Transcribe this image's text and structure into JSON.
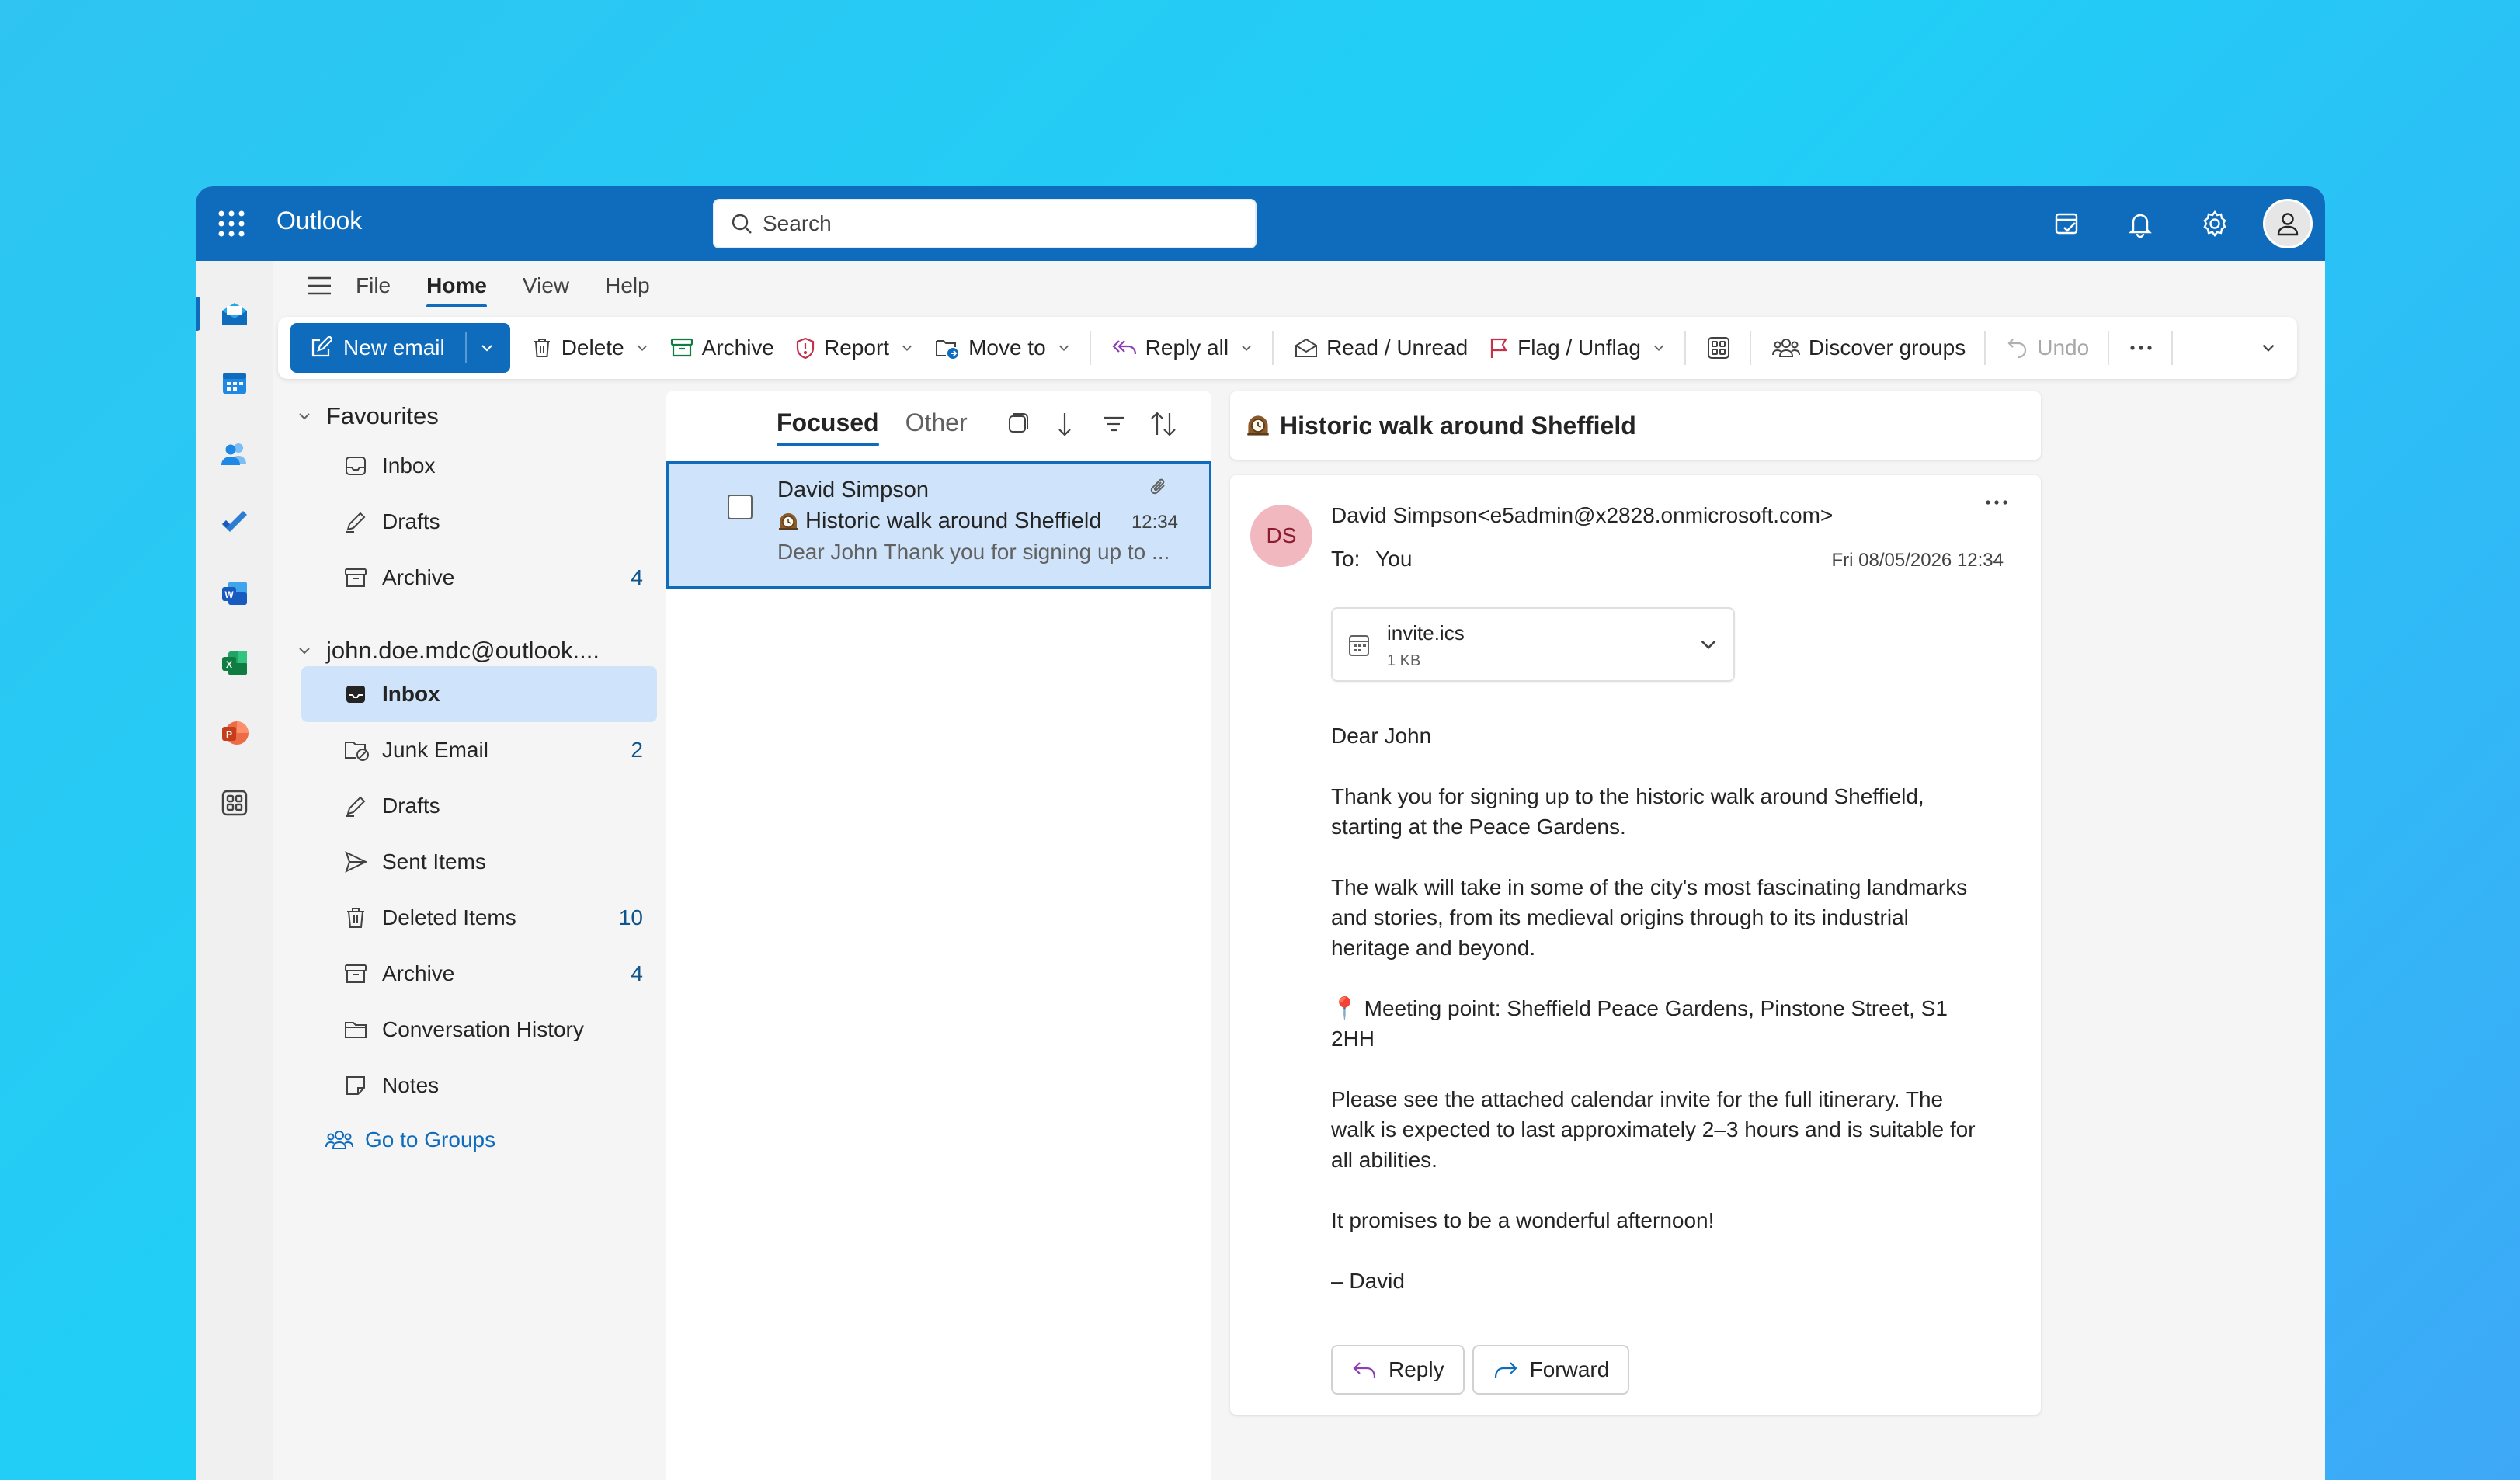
{
  "app": {
    "title": "Outlook"
  },
  "search": {
    "placeholder": "Search"
  },
  "menu": {
    "tabs": [
      "File",
      "Home",
      "View",
      "Help"
    ],
    "selected": "Home"
  },
  "ribbon": {
    "new_email": "New email",
    "delete": "Delete",
    "archive": "Archive",
    "report": "Report",
    "move_to": "Move to",
    "reply_all": "Reply all",
    "read_unread": "Read / Unread",
    "flag_unflag": "Flag / Unflag",
    "discover_groups": "Discover groups",
    "undo": "Undo"
  },
  "favourites": {
    "header": "Favourites",
    "items": [
      {
        "label": "Inbox",
        "count": ""
      },
      {
        "label": "Drafts",
        "count": ""
      },
      {
        "label": "Archive",
        "count": "4"
      }
    ]
  },
  "account": {
    "header": "john.doe.mdc@outlook....",
    "items": [
      {
        "label": "Inbox",
        "count": "",
        "selected": true
      },
      {
        "label": "Junk Email",
        "count": "2"
      },
      {
        "label": "Drafts",
        "count": ""
      },
      {
        "label": "Sent Items",
        "count": ""
      },
      {
        "label": "Deleted Items",
        "count": "10"
      },
      {
        "label": "Archive",
        "count": "4"
      },
      {
        "label": "Conversation History",
        "count": ""
      },
      {
        "label": "Notes",
        "count": ""
      }
    ]
  },
  "groups_link": "Go to Groups",
  "list": {
    "tabs": [
      "Focused",
      "Other"
    ],
    "selected_tab": "Focused",
    "messages": [
      {
        "from": "David Simpson",
        "subject": "Historic walk around Sheffield",
        "preview": "Dear John Thank you for signing up to ...",
        "time": "12:34",
        "has_attachment": true
      }
    ]
  },
  "reading": {
    "subject": "Historic walk around Sheffield",
    "avatar_initials": "DS",
    "sender": "David Simpson<e5admin@x2828.onmicrosoft.com>",
    "to_label": "To:",
    "to": "You",
    "date": "Fri 08/05/2026 12:34",
    "attachment": {
      "name": "invite.ics",
      "size": "1 KB"
    },
    "body": [
      "Dear John",
      "Thank you for signing up to the historic walk around Sheffield, starting at the Peace Gardens.",
      "The walk will take in some of the city's most fascinating landmarks and stories, from its medieval origins through to its industrial heritage and beyond.",
      "📍 Meeting point: Sheffield Peace Gardens, Pinstone Street, S1 2HH",
      "Please see the attached calendar invite for the full itinerary. The walk is expected to last approximately 2–3 hours and is suitable for all abilities.",
      "It promises to be a wonderful afternoon!",
      "– David"
    ],
    "reply": "Reply",
    "forward": "Forward"
  },
  "colors": {
    "brand": "#0f6cbd",
    "selected_bg": "#cfe4fa",
    "avatar_bg": "#f1b8c0"
  }
}
